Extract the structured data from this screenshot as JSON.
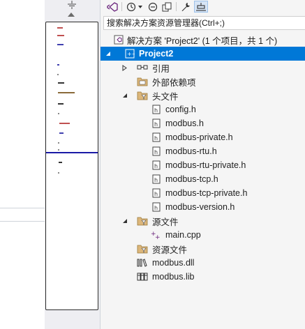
{
  "search": {
    "placeholder": "搜索解决方案资源管理器(Ctrl+;)"
  },
  "solution": {
    "label": "解决方案 'Project2' (1 个项目，共 1 个)"
  },
  "project": {
    "label": "Project2"
  },
  "tree": {
    "references": "引用",
    "external_deps": "外部依赖项",
    "header_files": "头文件",
    "headers": [
      "config.h",
      "modbus.h",
      "modbus-private.h",
      "modbus-rtu.h",
      "modbus-rtu-private.h",
      "modbus-tcp.h",
      "modbus-tcp-private.h",
      "modbus-version.h"
    ],
    "source_files": "源文件",
    "sources": [
      "main.cpp"
    ],
    "resource_files": "资源文件",
    "dll": "modbus.dll",
    "lib": "modbus.lib"
  },
  "colors": {
    "selection": "#0078d7",
    "folder": "#dcb67a",
    "minimap_separator": "#1a1aa6"
  }
}
